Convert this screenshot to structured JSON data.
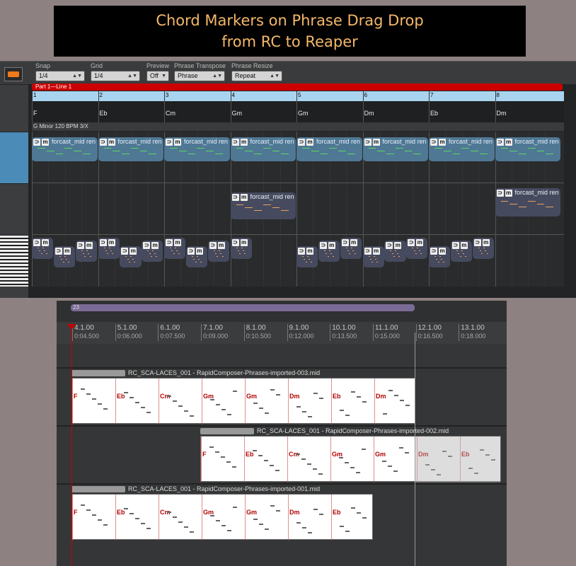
{
  "banner": {
    "line1": "Chord Markers on Phrase Drag Drop",
    "line2": "from RC to Reaper"
  },
  "toolbar": {
    "snap": {
      "label": "Snap",
      "value": "1/4"
    },
    "grid": {
      "label": "Grid",
      "value": "1/4"
    },
    "preview": {
      "label": "Preview",
      "value": "Off"
    },
    "transpose": {
      "label": "Phrase Transpose",
      "value": "Phrase"
    },
    "resize": {
      "label": "Phrase Resize",
      "value": "Repeat"
    }
  },
  "part_label": "Part 1—Line 1",
  "bars": [
    "1",
    "2",
    "3",
    "4",
    "5",
    "6",
    "7",
    "8"
  ],
  "rc_chords": [
    "F",
    "Eb",
    "Cm",
    "Gm",
    "Gm",
    "Dm",
    "Eb",
    "Dm"
  ],
  "key_info": "G Minor  120 BPM  3/X",
  "phrase_label": "forcast_mid ren",
  "reaper": {
    "region": "23",
    "ticks": [
      {
        "main": "4.1.00",
        "sub": "0:04.500"
      },
      {
        "main": "5.1.00",
        "sub": "0:06.000"
      },
      {
        "main": "6.1.00",
        "sub": "0:07.500"
      },
      {
        "main": "7.1.00",
        "sub": "0:09.000"
      },
      {
        "main": "8.1.00",
        "sub": "0:10.500"
      },
      {
        "main": "9.1.00",
        "sub": "0:12.000"
      },
      {
        "main": "10.1.00",
        "sub": "0:13.500"
      },
      {
        "main": "11.1.00",
        "sub": "0:15.000"
      },
      {
        "main": "12.1.00",
        "sub": "0:16.500"
      },
      {
        "main": "13.1.00",
        "sub": "0:18.000"
      }
    ],
    "items": [
      {
        "name": "RC_SCA-LACES_001 - RapidComposer-Phrases-imported-003.mid",
        "chords": [
          "F",
          "Eb",
          "Cm",
          "Gm",
          "Gm",
          "Dm",
          "Eb",
          "Dm"
        ]
      },
      {
        "name": "RC_SCA-LACES_001 - RapidComposer-Phrases-imported-002.mid",
        "chords": [
          "F",
          "Eb",
          "Cm",
          "Gm",
          "Gm",
          "Dm",
          "Eb"
        ]
      },
      {
        "name": "RC_SCA-LACES_001 - RapidComposer-Phrases-imported-001.mid",
        "chords": [
          "F",
          "Eb",
          "Cm",
          "Gm",
          "Gm",
          "Dm",
          "Eb"
        ]
      }
    ]
  },
  "colors": {
    "banner_text": "#f5b86a",
    "part_bar": "#cc0000",
    "ruler": "#a9d4f0",
    "chord_marker": "#b00000",
    "region": "#7a6a96"
  }
}
